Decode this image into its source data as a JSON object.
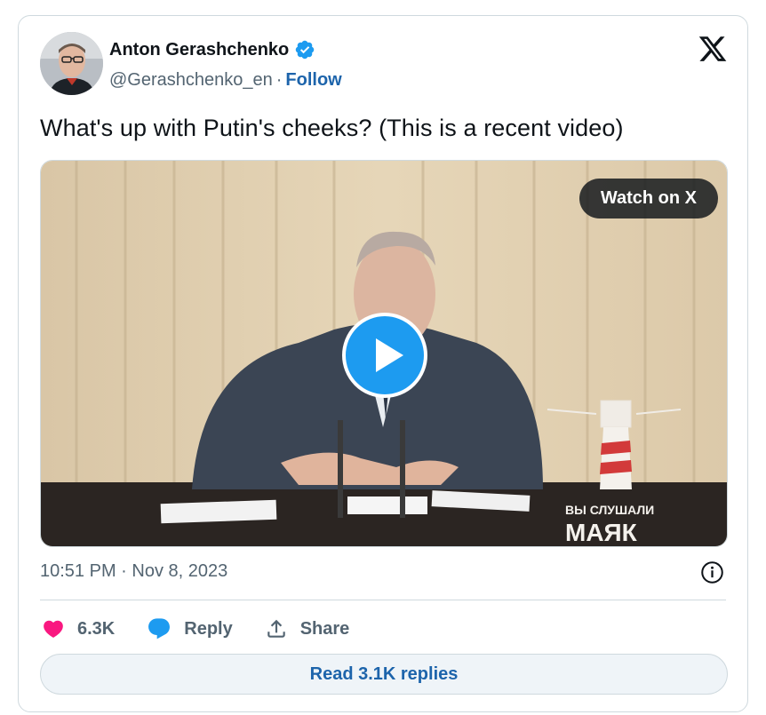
{
  "author": {
    "name": "Anton Gerashchenko",
    "handle": "@Gerashchenko_en",
    "separator": "·",
    "follow_label": "Follow"
  },
  "tweet": {
    "text": "What's up with Putin's cheeks? (This is a recent video)",
    "timestamp": "10:51 PM · Nov 8, 2023"
  },
  "media": {
    "watch_label": "Watch on X",
    "watermark_line1": "ВЫ СЛУШАЛИ",
    "watermark_line2": "МАЯК"
  },
  "actions": {
    "likes": "6.3K",
    "reply_label": "Reply",
    "share_label": "Share"
  },
  "read_replies_label": "Read 3.1K replies",
  "colors": {
    "accent": "#1d9bf0",
    "link": "#1d64ab",
    "like": "#f91880",
    "text": "#0f1419",
    "muted": "#536471"
  },
  "icons": [
    "verified-badge-icon",
    "x-logo-icon",
    "play-icon",
    "info-icon",
    "heart-icon",
    "reply-bubble-icon",
    "share-icon",
    "lighthouse-icon"
  ]
}
